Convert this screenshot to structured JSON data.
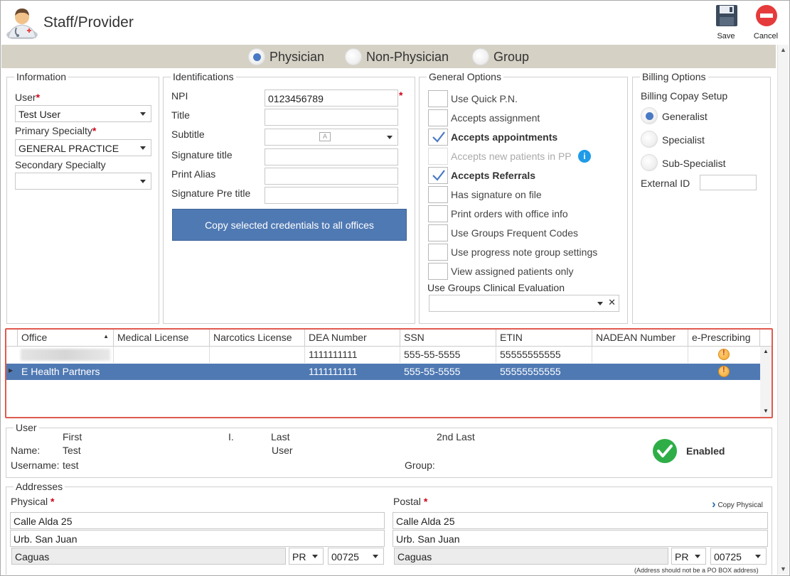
{
  "header": {
    "title": "Staff/Provider",
    "save_label": "Save",
    "cancel_label": "Cancel"
  },
  "provider_types": [
    {
      "label": "Physician",
      "selected": true
    },
    {
      "label": "Non-Physician",
      "selected": false
    },
    {
      "label": "Group",
      "selected": false
    }
  ],
  "information": {
    "title": "Information",
    "user_label": "User",
    "user_value": "Test User",
    "primary_specialty_label": "Primary Specialty",
    "primary_specialty_value": "GENERAL PRACTICE",
    "secondary_specialty_label": "Secondary Specialty",
    "secondary_specialty_value": ""
  },
  "identifications": {
    "title": "Identifications",
    "npi_label": "NPI",
    "npi_value": "0123456789",
    "title_label": "Title",
    "subtitle_label": "Subtitle",
    "signature_title_label": "Signature title",
    "print_alias_label": "Print Alias",
    "signature_pre_title_label": "Signature Pre title",
    "copy_button": "Copy selected credentials to all offices"
  },
  "general_options": {
    "title": "General Options",
    "items": [
      {
        "label": "Use Quick P.N.",
        "checked": false,
        "disabled": false
      },
      {
        "label": "Accepts assignment",
        "checked": false,
        "disabled": false
      },
      {
        "label": "Accepts appointments",
        "checked": true,
        "disabled": false
      },
      {
        "label": "Accepts new patients in PP",
        "checked": false,
        "disabled": true
      },
      {
        "label": "Accepts Referrals",
        "checked": true,
        "disabled": false
      },
      {
        "label": "Has signature on file",
        "checked": false,
        "disabled": false
      },
      {
        "label": "Print orders with office info",
        "checked": false,
        "disabled": false
      },
      {
        "label": "Use Groups Frequent Codes",
        "checked": false,
        "disabled": false
      },
      {
        "label": "Use progress note group settings",
        "checked": false,
        "disabled": false
      },
      {
        "label": "View assigned patients only",
        "checked": false,
        "disabled": false
      }
    ],
    "clinical_eval_label": "Use Groups Clinical Evaluation"
  },
  "billing": {
    "title": "Billing Options",
    "copay_label": "Billing Copay Setup",
    "options": [
      {
        "label": "Generalist",
        "selected": true
      },
      {
        "label": "Specialist",
        "selected": false
      },
      {
        "label": "Sub-Specialist",
        "selected": false
      }
    ],
    "external_id_label": "External ID"
  },
  "grid": {
    "columns": [
      "Office",
      "Medical License",
      "Narcotics License",
      "DEA Number",
      "SSN",
      "ETIN",
      "NADEAN Number",
      "e-Prescribing"
    ],
    "rows": [
      {
        "office": "",
        "medical": "",
        "narcotics": "",
        "dea": "1111111111",
        "ssn": "555-55-5555",
        "etin": "55555555555",
        "nadean": ""
      },
      {
        "office": "E Health Partners",
        "medical": "",
        "narcotics": "",
        "dea": "1111111111",
        "ssn": "555-55-5555",
        "etin": "55555555555",
        "nadean": ""
      }
    ]
  },
  "user": {
    "title": "User",
    "first_label": "First",
    "i_label": "I.",
    "last_label": "Last",
    "second_last_label": "2nd Last",
    "name_label": "Name:",
    "first_value": "Test",
    "last_value": "User",
    "username_label": "Username:",
    "username_value": "test",
    "group_label": "Group:",
    "status": "Enabled"
  },
  "addresses": {
    "title": "Addresses",
    "physical_label": "Physical",
    "postal_label": "Postal",
    "copy_physical": "Copy Physical",
    "physical": {
      "line1": "Calle Alda 25",
      "line2": "Urb. San Juan",
      "city": "Caguas",
      "state": "PR",
      "zip": "00725"
    },
    "postal": {
      "line1": "Calle Alda 25",
      "line2": "Urb. San Juan",
      "city": "Caguas",
      "state": "PR",
      "zip": "00725"
    },
    "note": "(Address should not be a PO BOX address)"
  }
}
